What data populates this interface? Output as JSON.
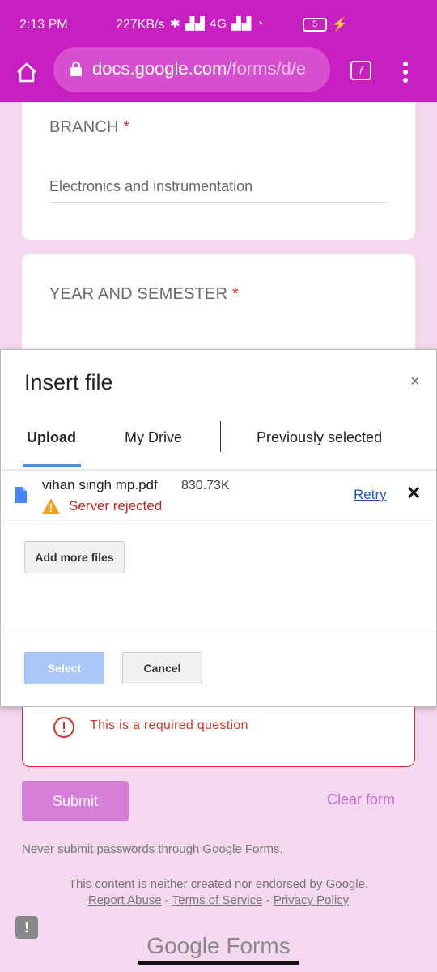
{
  "status_bar": {
    "time": "2:13 PM",
    "speed": "227KB/s",
    "network": "4G",
    "battery": "5"
  },
  "browser": {
    "url_host": "docs.google.com",
    "url_path": "/forms/d/e",
    "tab_count": "7"
  },
  "form": {
    "branch": {
      "title": "BRANCH",
      "required_mark": "*",
      "answer": "Electronics and instrumentation"
    },
    "year_semester": {
      "title": "YEAR AND SEMESTER",
      "required_mark": "*"
    },
    "error_message": "This is a required question",
    "submit_label": "Submit",
    "clear_label": "Clear form",
    "password_note": "Never submit passwords through Google Forms.",
    "disclaimer": "This content is neither created nor endorsed by Google.",
    "footer_links": {
      "report": "Report Abuse",
      "sep1": " - ",
      "terms": "Terms of Service",
      "sep2": " - ",
      "privacy": "Privacy Policy"
    },
    "logo": "Google Forms"
  },
  "dialog": {
    "title": "Insert file",
    "close": "×",
    "tabs": {
      "upload": "Upload",
      "drive": "My Drive",
      "previous": "Previously selected"
    },
    "file": {
      "name": "vihan singh mp.pdf",
      "size": "830.73K",
      "status": "Server rejected",
      "retry": "Retry",
      "remove": "✕"
    },
    "add_more": "Add more files",
    "select": "Select",
    "cancel": "Cancel"
  },
  "colors": {
    "brand": "#c81fc0",
    "background": "#f3d8f0",
    "error": "#d93025",
    "link": "#1a56c4",
    "select_disabled": "#a9c8f7"
  }
}
